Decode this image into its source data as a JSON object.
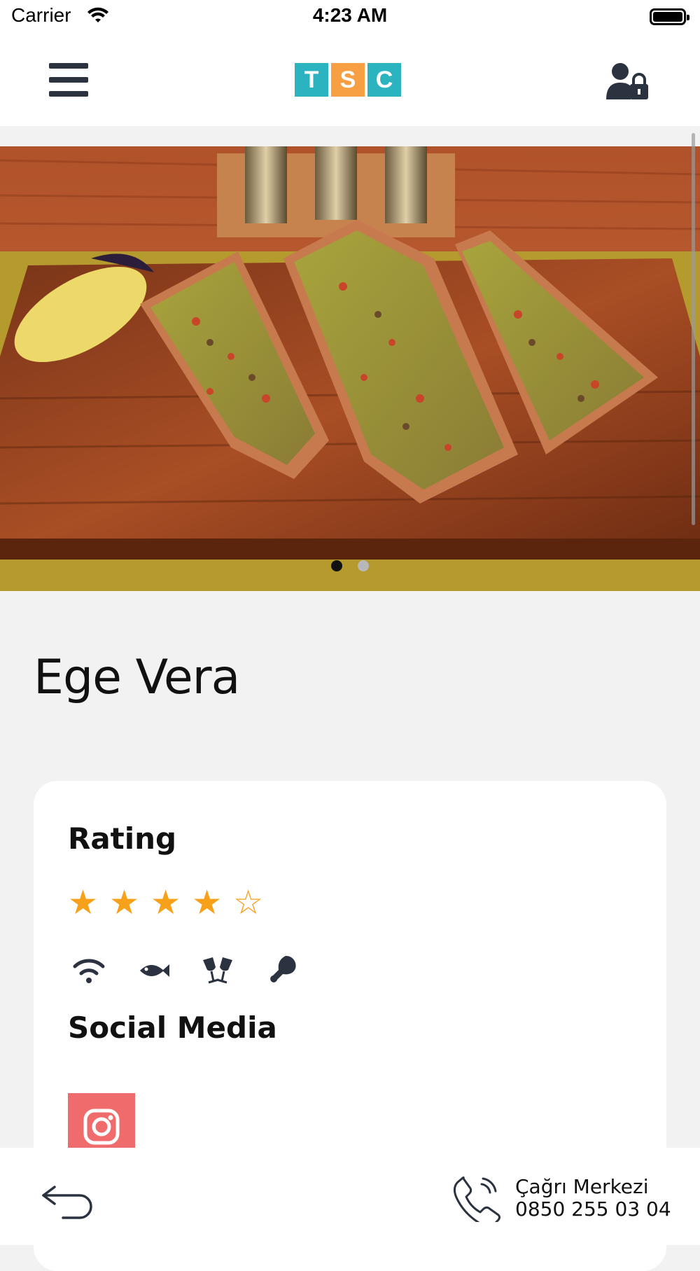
{
  "status_bar": {
    "carrier": "Carrier",
    "time": "4:23 AM"
  },
  "header": {
    "logo_letters": [
      "T",
      "S",
      "C"
    ],
    "logo_colors": [
      "#2bb3c0",
      "#f7a043",
      "#2bb3c0"
    ],
    "menu_icon": "hamburger-icon",
    "account_icon": "user-lock-icon"
  },
  "carousel": {
    "page_count": 2,
    "active_index": 0
  },
  "venue": {
    "name": "Ege Vera"
  },
  "rating": {
    "heading": "Rating",
    "value": 4,
    "max": 5
  },
  "amenities": [
    "wifi-icon",
    "fish-icon",
    "cheers-glasses-icon",
    "chicken-leg-icon"
  ],
  "social": {
    "heading": "Social Media",
    "items": [
      "instagram-icon"
    ],
    "color": "#f06c6c"
  },
  "footer": {
    "back_icon": "back-arrow-icon",
    "call_center_label": "Çağrı Merkezi",
    "call_center_number": "0850 255 03 04"
  },
  "colors": {
    "accent_star": "#f7a01a",
    "icon_dark": "#2b3240",
    "background": "#f2f2f2"
  }
}
